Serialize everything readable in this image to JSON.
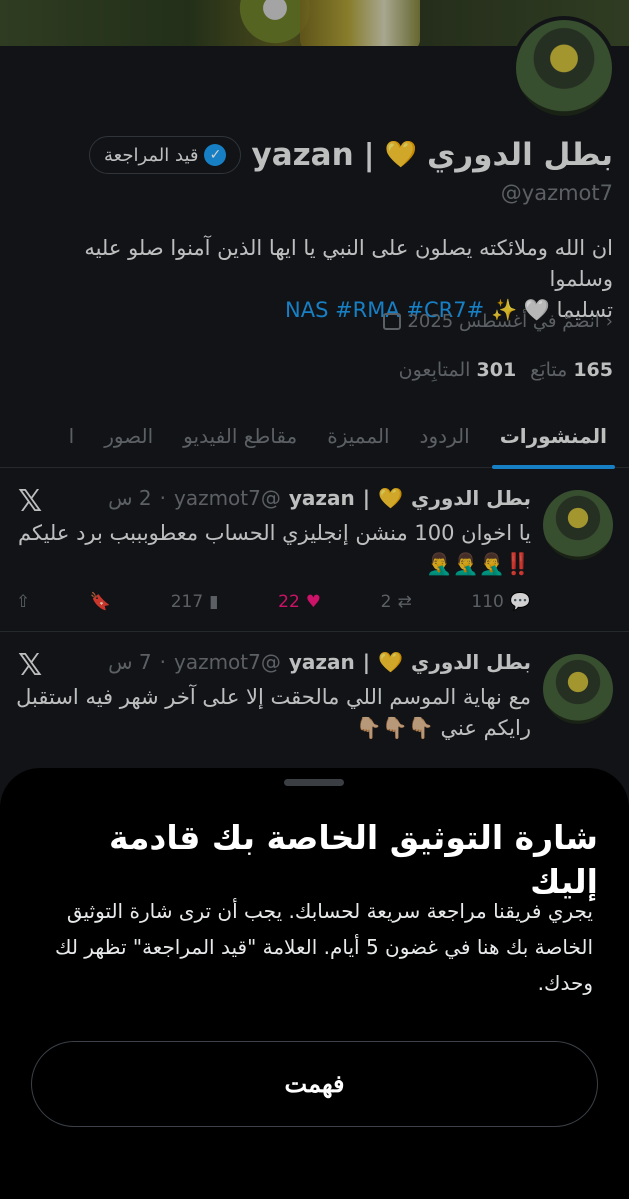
{
  "profile": {
    "display_name": "بطل الدوري",
    "name_suffix": "yazan",
    "separator": "|",
    "heart": "💛",
    "review_badge": "قيد المراجعة",
    "handle": "@yazmot7",
    "bio_line1": "ان الله وملائكته يصلون على النبي يا ايها الذين آمنوا صلو عليه وسلموا",
    "bio_line2_text": "تسليما 🤍 ✨",
    "bio_tags": "#NAS #RMA #CR7",
    "joined": "انضمّ في أغسطس 2025",
    "following_count": "165",
    "following_label": "متابَع",
    "followers_count": "301",
    "followers_label": "المتابِعون"
  },
  "tabs": [
    "المنشورات",
    "الردود",
    "المميزة",
    "مقاطع الفيديو",
    "الصور",
    "ا"
  ],
  "tweets": [
    {
      "name": "بطل الدوري",
      "heart": "💛",
      "separator": "|",
      "user": "yazan",
      "handle": "@yazmot7",
      "time": "2 س",
      "dot": "·",
      "text": "يا اخوان 100 منشن إنجليزي الحساب معطوبببب برد عليكم ‼️🤦‍♂️🤦‍♂️🤦‍♂️",
      "replies": "110",
      "retweets": "2",
      "likes": "22",
      "views": "217"
    },
    {
      "name": "بطل الدوري",
      "heart": "💛",
      "separator": "|",
      "user": "yazan",
      "handle": "@yazmot7",
      "time": "7 س",
      "dot": "·",
      "text": "مع نهاية الموسم اللي مالحقت إلا على آخر شهر فيه استقبل رايكم عني 👇🏼👇🏼👇🏼"
    }
  ],
  "sheet": {
    "title": "شارة التوثيق الخاصة بك قادمة إليك",
    "body": "يجري فريقنا مراجعة سريعة لحسابك. يجب أن ترى شارة التوثيق الخاصة بك هنا في غضون 5 أيام. العلامة \"قيد المراجعة\" تظهر لك وحدك.",
    "button": "فهمت"
  },
  "icons": {
    "x_logo": "𝕏",
    "reply": "reply-icon",
    "retweet": "retweet-icon",
    "like": "heart-icon",
    "views": "views-icon",
    "bookmark": "bookmark-icon",
    "share": "share-icon"
  },
  "colors": {
    "accent": "#1d9bf0",
    "like": "#f91880",
    "background": "#15181c",
    "sheet": "#000000"
  }
}
